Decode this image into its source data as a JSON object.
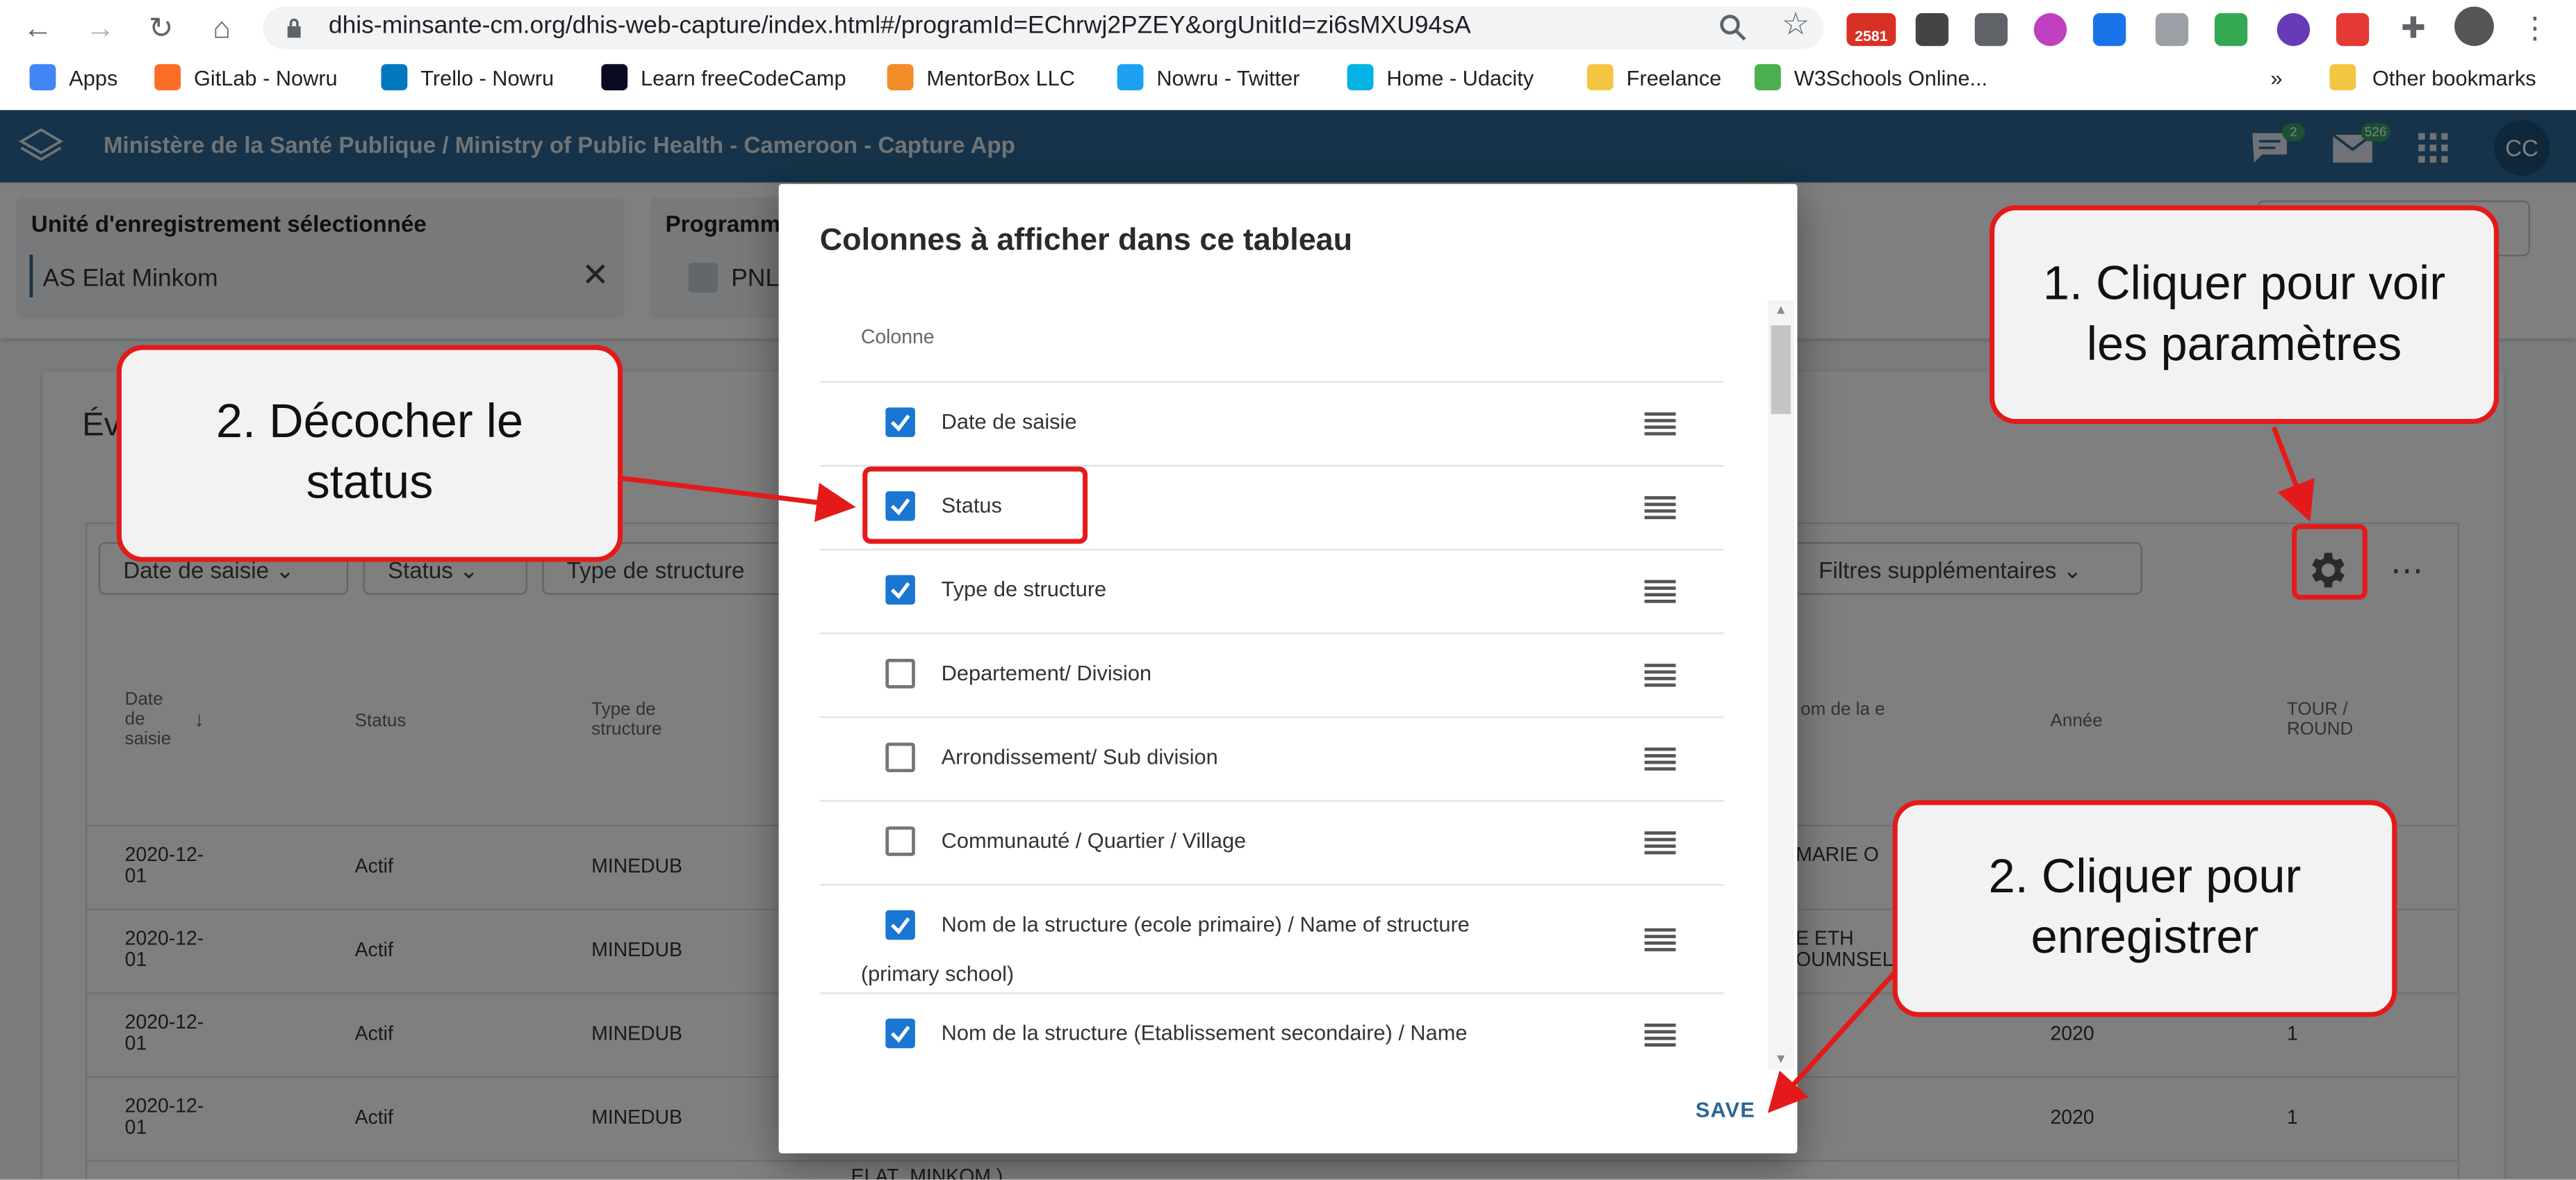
{
  "browser": {
    "url": "dhis-minsante-cm.org/dhis-web-capture/index.html#/programId=EChrwj2PZEY&orgUnitId=zi6sMXU94sA",
    "badge_count": "2581",
    "bookmarks": [
      {
        "label": "Apps",
        "color": "#4285f4"
      },
      {
        "label": "GitLab - Nowru",
        "color": "#fc6d26"
      },
      {
        "label": "Trello - Nowru",
        "color": "#0079bf"
      },
      {
        "label": "Learn freeCodeCamp",
        "color": "#0a0a23"
      },
      {
        "label": "MentorBox LLC",
        "color": "#f28c28"
      },
      {
        "label": "Nowru - Twitter",
        "color": "#1da1f2"
      },
      {
        "label": "Home - Udacity",
        "color": "#02b3e4"
      },
      {
        "label": "Freelance",
        "color": "#f4c542"
      },
      {
        "label": "W3Schools Online...",
        "color": "#4caf50"
      }
    ],
    "more_bookmarks": "»",
    "other_bookmarks": "Other bookmarks"
  },
  "header": {
    "title": "Ministère de la Santé Publique / Ministry of Public Health - Cameroon - Capture App",
    "messages_count": "2",
    "mail_count": "526",
    "avatar": "CC"
  },
  "selection": {
    "org_label": "Unité d'enregistrement sélectionnée",
    "org_value": "AS Elat Minkom",
    "program_label": "Programm",
    "program_value": "PNL"
  },
  "events": {
    "title_fragment": "Év",
    "filters": [
      "Date de saisie",
      "Status",
      "Type de structure"
    ],
    "more_filters": "Filtres supplémentaires",
    "columns_left": [
      {
        "label": "Date de saisie",
        "sort_icon": "arrow-down-icon"
      },
      {
        "label": "Status"
      },
      {
        "label": "Type de structure"
      }
    ],
    "columns_right": [
      "om de la e",
      "Année",
      "TOUR / ROUND"
    ],
    "rows": [
      {
        "date": "2020-12-01",
        "status": "Actif",
        "type": "MINEDUB",
        "right_name": "MARIE O",
        "year": "",
        "round": ""
      },
      {
        "date": "2020-12-01",
        "status": "Actif",
        "type": "MINEDUB",
        "right_name": "E ETH OUMNSEL",
        "year": "",
        "round": ""
      },
      {
        "date": "2020-12-01",
        "status": "Actif",
        "type": "MINEDUB",
        "right_name": "",
        "year": "2020",
        "round": "1"
      },
      {
        "date": "2020-12-01",
        "status": "Actif",
        "type": "MINEDUB",
        "right_name": "",
        "year": "2020",
        "round": "1"
      }
    ],
    "footer_fragment": "ELAT_MINKOM )"
  },
  "dialog": {
    "title": "Colonnes à afficher dans ce tableau",
    "column_header": "Colonne",
    "items": [
      {
        "label": "Date de saisie",
        "checked": true
      },
      {
        "label": "Status",
        "checked": true
      },
      {
        "label": "Type de structure",
        "checked": true
      },
      {
        "label": "Departement/ Division",
        "checked": false
      },
      {
        "label": "Arrondissement/ Sub division",
        "checked": false
      },
      {
        "label": "Communauté / Quartier / Village",
        "checked": false
      },
      {
        "label": "Nom de la structure (ecole primaire) / Name of structure",
        "label_line2": "(primary school)",
        "checked": true
      },
      {
        "label": "Nom de la structure (Etablissement secondaire) / Name",
        "checked": true
      }
    ],
    "save_label": "SAVE"
  },
  "callouts": {
    "settings": "1. Cliquer pour voir\nles paramètres",
    "uncheck": "2. Décocher le\nstatus",
    "save": "2. Cliquer pour\nenregistrer"
  },
  "colors": {
    "app_header": "#2c6693",
    "checkbox_checked": "#1976d2",
    "callout_border": "#e41a1a",
    "callout_fill": "#f2f2f2"
  }
}
